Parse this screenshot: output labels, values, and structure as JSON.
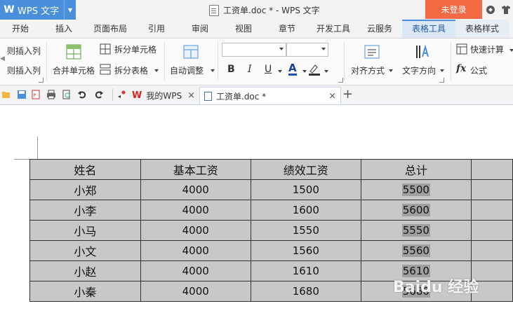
{
  "titlebar": {
    "app_name": "WPS 文字",
    "app_logo": "W",
    "document_title": "工资单.doc * - WPS 文字",
    "login_label": "未登录"
  },
  "tabs": [
    {
      "label": "开始"
    },
    {
      "label": "插入"
    },
    {
      "label": "页面布局"
    },
    {
      "label": "引用"
    },
    {
      "label": "审阅"
    },
    {
      "label": "视图"
    },
    {
      "label": "章节"
    },
    {
      "label": "开发工具"
    },
    {
      "label": "云服务"
    },
    {
      "label": "表格工具"
    },
    {
      "label": "表格样式"
    }
  ],
  "ribbon": {
    "insert_col_left": "则插入列",
    "insert_col_right": "则插入列",
    "merge_cells": "合并单元格",
    "split_cells": "拆分单元格",
    "split_table": "拆分表格",
    "auto_fit": "自动调整",
    "align": "对齐方式",
    "text_direction": "文字方向",
    "quick_calc": "快速计算",
    "formula": "公式",
    "formula_icon": "fx",
    "bold": "B",
    "italic": "I",
    "underline": "U",
    "font_color": "A"
  },
  "doc_tabs": {
    "my_wps": "我的WPS",
    "current_doc": "工资单.doc *",
    "new_tab": "+"
  },
  "table": {
    "headers": [
      "姓名",
      "基本工资",
      "绩效工资",
      "总计",
      ""
    ],
    "rows": [
      {
        "name": "小郑",
        "base": "4000",
        "perf": "1500",
        "total": "5500"
      },
      {
        "name": "小李",
        "base": "4000",
        "perf": "1600",
        "total": "5600"
      },
      {
        "name": "小马",
        "base": "4000",
        "perf": "1550",
        "total": "5550"
      },
      {
        "name": "小文",
        "base": "4000",
        "perf": "1560",
        "total": "5560"
      },
      {
        "name": "小赵",
        "base": "4000",
        "perf": "1610",
        "total": "5610"
      },
      {
        "name": "小秦",
        "base": "4000",
        "perf": "1680",
        "total": "5680"
      }
    ]
  },
  "watermark": "Baidu 经验",
  "colors": {
    "accent": "#4a8fdc",
    "login": "#f16a43",
    "table_bg": "#c8c8c8",
    "highlight": "#a0a0a0"
  }
}
